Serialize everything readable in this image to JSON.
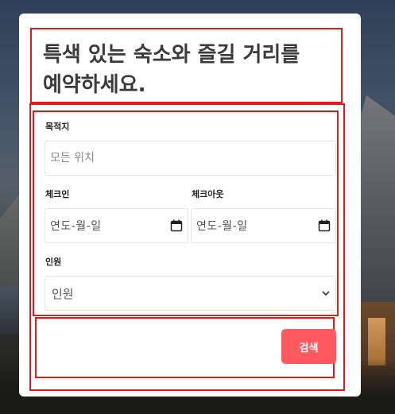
{
  "hero": {
    "title": "특색 있는 숙소와 즐길 거리를 예약하세요."
  },
  "form": {
    "destination": {
      "label": "목적지",
      "placeholder": "모든 위치"
    },
    "checkin": {
      "label": "체크인",
      "value": "연도-월-일",
      "icon": "calendar-icon"
    },
    "checkout": {
      "label": "체크아웃",
      "value": "연도-월-일",
      "icon": "calendar-icon"
    },
    "guests": {
      "label": "인원",
      "value": "인원",
      "icon": "chevron-down-icon"
    },
    "search_label": "검색"
  },
  "colors": {
    "accent": "#ff5a5f",
    "annotation_outline": "#e01b1b",
    "title_text": "#3b3b3b"
  }
}
